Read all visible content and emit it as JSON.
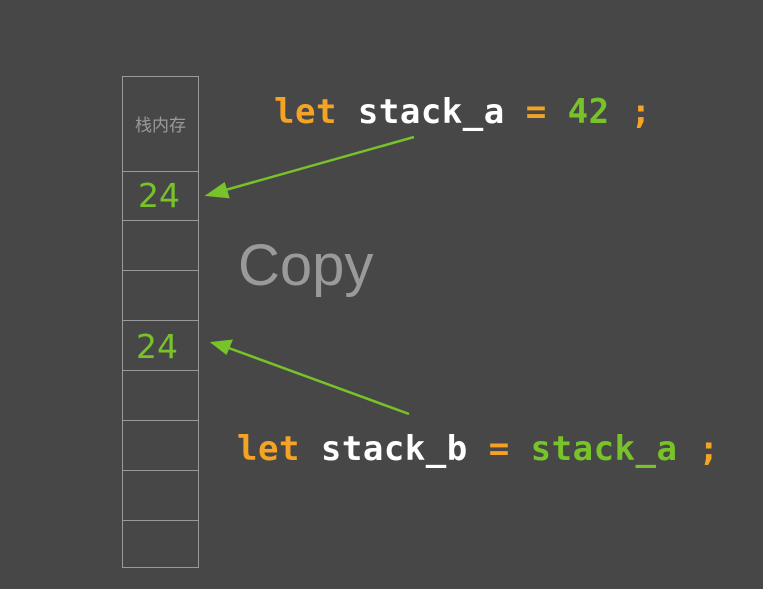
{
  "stack": {
    "title": "栈内存",
    "value_a": "24",
    "value_b": "24"
  },
  "line1": {
    "kw": "let",
    "var": "stack_a",
    "eq": "=",
    "value": "42",
    "semi": ";"
  },
  "line2": {
    "kw": "let",
    "var": "stack_b",
    "eq": "=",
    "value": "stack_a",
    "semi": ";"
  },
  "label": "Copy",
  "colors": {
    "background": "#474747",
    "keyword": "#f4a324",
    "value": "#78c22a",
    "identifier": "#ffffff",
    "muted": "#9a9a9a"
  }
}
